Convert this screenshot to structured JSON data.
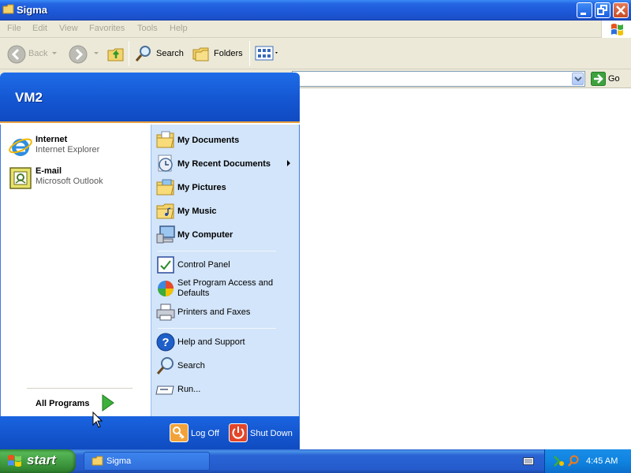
{
  "window": {
    "title": "Sigma",
    "menu": [
      "File",
      "Edit",
      "View",
      "Favorites",
      "Tools",
      "Help"
    ],
    "toolbar": {
      "back_label": "Back",
      "search_label": "Search",
      "folders_label": "Folders"
    },
    "address": {
      "value": "",
      "go_label": "Go"
    }
  },
  "start_menu": {
    "user": "VM2",
    "pinned": [
      {
        "title": "Internet",
        "subtitle": "Internet Explorer",
        "icon": "ie-icon"
      },
      {
        "title": "E-mail",
        "subtitle": "Microsoft Outlook",
        "icon": "outlook-icon"
      }
    ],
    "all_programs_label": "All Programs",
    "places": [
      {
        "label": "My Documents",
        "icon": "folder-documents-icon"
      },
      {
        "label": "My Recent Documents",
        "icon": "recent-documents-icon"
      },
      {
        "label": "My Pictures",
        "icon": "folder-pictures-icon"
      },
      {
        "label": "My Music",
        "icon": "folder-music-icon"
      },
      {
        "label": "My Computer",
        "icon": "computer-icon"
      }
    ],
    "settings": [
      {
        "label": "Control Panel",
        "icon": "control-panel-icon"
      },
      {
        "label": "Set Program Access and Defaults",
        "icon": "program-access-icon"
      },
      {
        "label": "Printers and Faxes",
        "icon": "printer-icon"
      }
    ],
    "tools": [
      {
        "label": "Help and Support",
        "icon": "help-icon"
      },
      {
        "label": "Search",
        "icon": "search-icon"
      },
      {
        "label": "Run...",
        "icon": "run-icon"
      }
    ],
    "logoff_label": "Log Off",
    "shutdown_label": "Shut Down"
  },
  "taskbar": {
    "start_label": "start",
    "task_label": "Sigma",
    "clock": "4:45 AM"
  },
  "colors": {
    "titlebar": "#2464e2",
    "start_button": "#3c9a3c",
    "taskbar": "#245bcc",
    "start_menu_right": "#d3e5fa"
  }
}
